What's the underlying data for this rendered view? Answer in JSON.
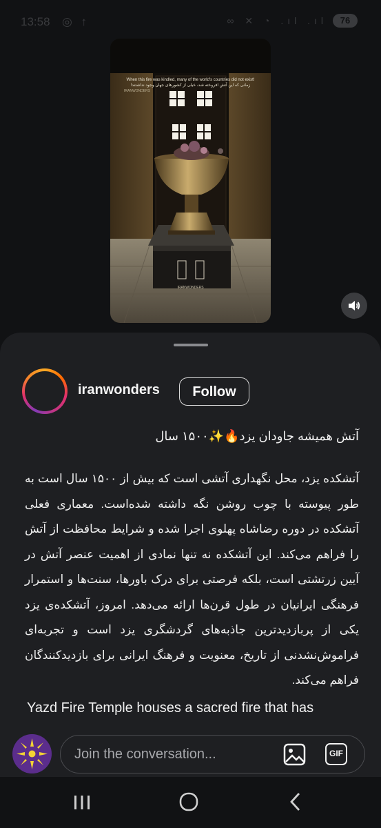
{
  "status_bar": {
    "time": "13:58",
    "left_icons": "◎ ↑",
    "right_icons": "∞ ✕ ◔ .ıl .ıl",
    "battery": "76"
  },
  "video": {
    "caption_en": "When this fire was kindled, many of the world's countries did not exist!",
    "caption_fa": "زمانی که این آتش افروخته شد، خیلی از کشورهای جهان وجود نداشتند!",
    "brand": "IRANWONDERS",
    "watermark": "IRANWONDERS"
  },
  "post": {
    "username": "iranwonders",
    "follow_label": "Follow",
    "title": "آتش همیشه جاودان یزد🔥✨۱۵۰۰ سال",
    "body": "آتشکده یزد، محل نگهداری آتشی است که بیش از ۱۵۰۰ سال است به طور پیوسته با چوب روشن نگه داشته شده‌است. معماری فعلی آتشکده در دوره رضاشاه پهلوی اجرا شده و شرایط محافظت از آتش را فراهم می‌کند. این آتشکده نه تنها نمادی از اهمیت عنصر آتش در آیین زرتشتی است، بلکه فرصتی برای درک باورها، سنت‌ها و استمرار فرهنگی ایرانیان در طول قرن‌ها ارائه می‌دهد. امروز، آتشکده‌ی یزد یکی از پربازدیدترین جاذبه‌های گردشگری یزد است و تجربه‌ای فراموش‌نشدنی از تاریخ، معنویت و فرهنگ ایرانی برای بازدیدکنندگان فراهم می‌کند.",
    "english": "Yazd Fire Temple houses a sacred fire that has"
  },
  "composer": {
    "placeholder": "Join the conversation...",
    "gif_label": "GIF"
  },
  "icons": {
    "sound": "speaker-icon",
    "gallery": "image-icon",
    "nav": [
      "recents-icon",
      "home-icon",
      "back-icon"
    ]
  },
  "colors": {
    "background": "#111214",
    "sheet": "#1e1f22",
    "story_ring": [
      "#f9a825",
      "#e1306c",
      "#833ab4"
    ]
  }
}
